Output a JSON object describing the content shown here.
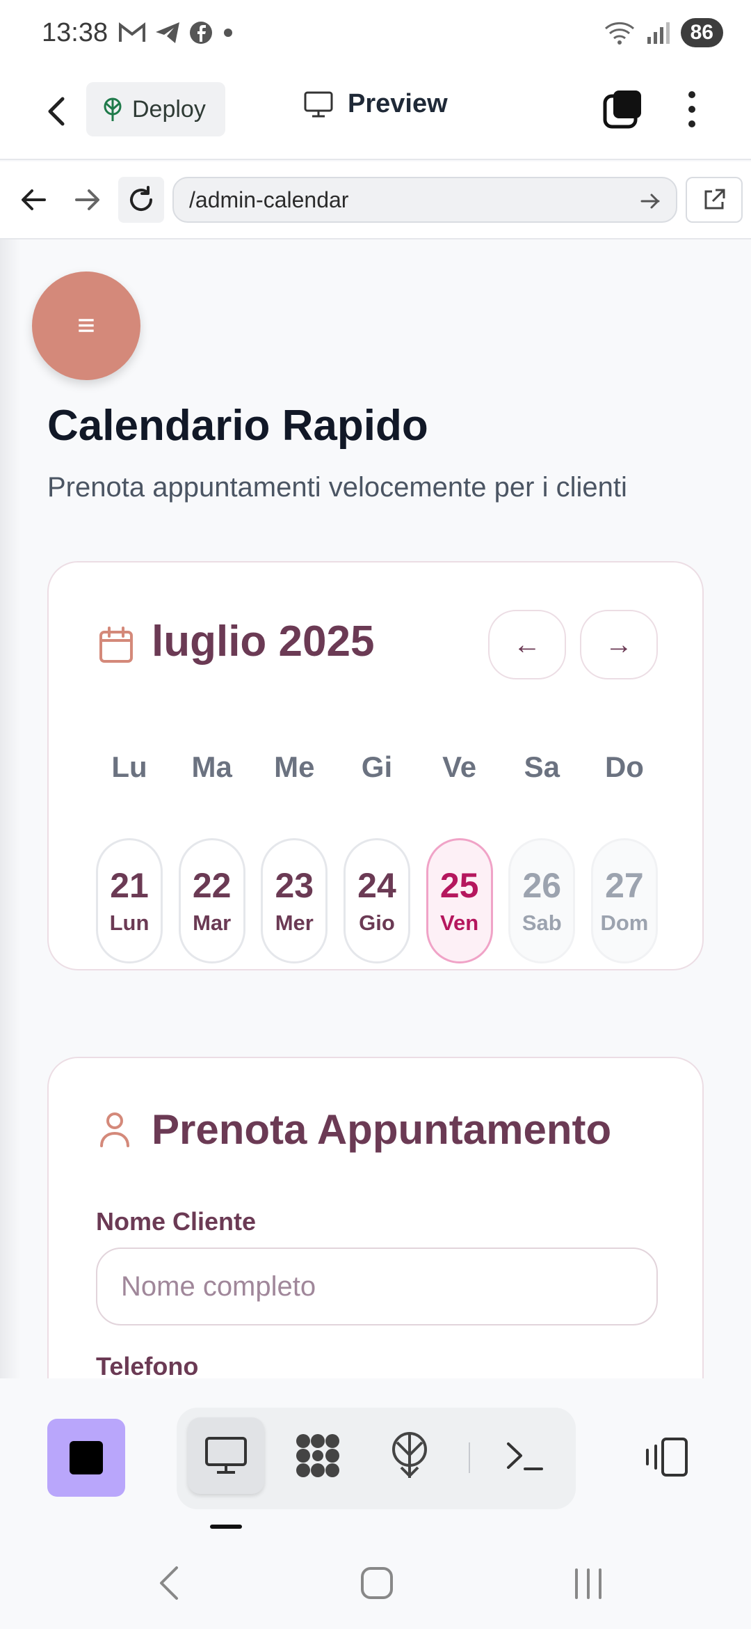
{
  "status_bar": {
    "time": "13:38",
    "battery": "86"
  },
  "app_bar": {
    "deploy_label": "Deploy",
    "preview_label": "Preview"
  },
  "browser": {
    "url": "/admin-calendar"
  },
  "page": {
    "menu_glyph": "≡",
    "title": "Calendario Rapido",
    "subtitle": "Prenota appuntamenti velocemente per i clienti"
  },
  "calendar": {
    "month_label": "luglio 2025",
    "prev_label": "←",
    "next_label": "→",
    "weekdays": [
      "Lu",
      "Ma",
      "Me",
      "Gi",
      "Ve",
      "Sa",
      "Do"
    ],
    "days": [
      {
        "num": "21",
        "label": "Lun"
      },
      {
        "num": "22",
        "label": "Mar"
      },
      {
        "num": "23",
        "label": "Mer"
      },
      {
        "num": "24",
        "label": "Gio"
      },
      {
        "num": "25",
        "label": "Ven"
      },
      {
        "num": "26",
        "label": "Sab"
      },
      {
        "num": "27",
        "label": "Dom"
      }
    ],
    "selected_day": "25"
  },
  "booking_form": {
    "title": "Prenota Appuntamento",
    "name_label": "Nome Cliente",
    "name_placeholder": "Nome completo",
    "name_value": "",
    "phone_label": "Telefono"
  },
  "colors": {
    "accent": "#6b3a54",
    "selected": "#b5175e",
    "fab": "#d4897a",
    "stop_button": "#b9a6fb"
  }
}
